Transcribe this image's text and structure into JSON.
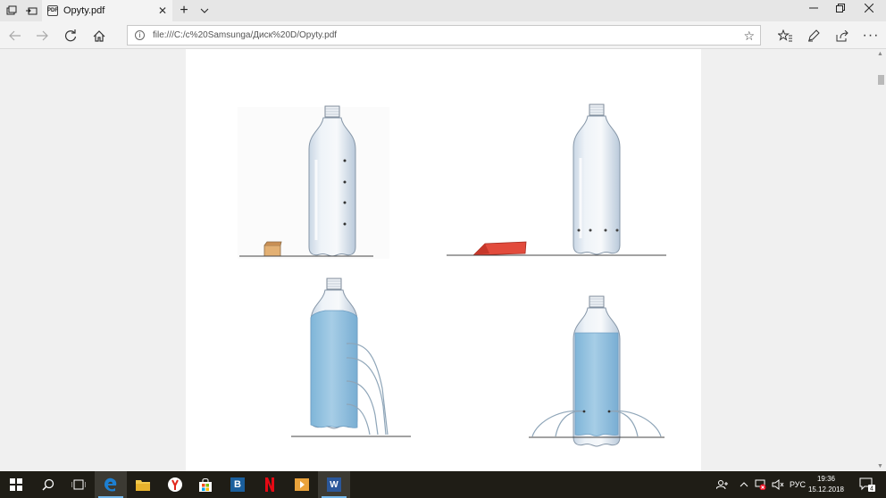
{
  "tab": {
    "title": "Opyty.pdf",
    "file_badge": "PDF"
  },
  "address": {
    "url": "file:///C:/c%20Samsunga/Диск%20D/Opyty.pdf"
  },
  "taskbar": {
    "apps": [
      "start",
      "search",
      "task-view",
      "edge",
      "file-explorer",
      "yandex",
      "store",
      "b-app",
      "netflix",
      "media",
      "word"
    ],
    "b_app_letter": "B",
    "word_letter": "W",
    "language": "РУС",
    "time": "19:36",
    "date": "15.12.2018",
    "notification_count": "4"
  },
  "colors": {
    "water": "#8fc0df",
    "taskbar": "#1f1d16",
    "edge_blue": "#1d7fd1"
  }
}
